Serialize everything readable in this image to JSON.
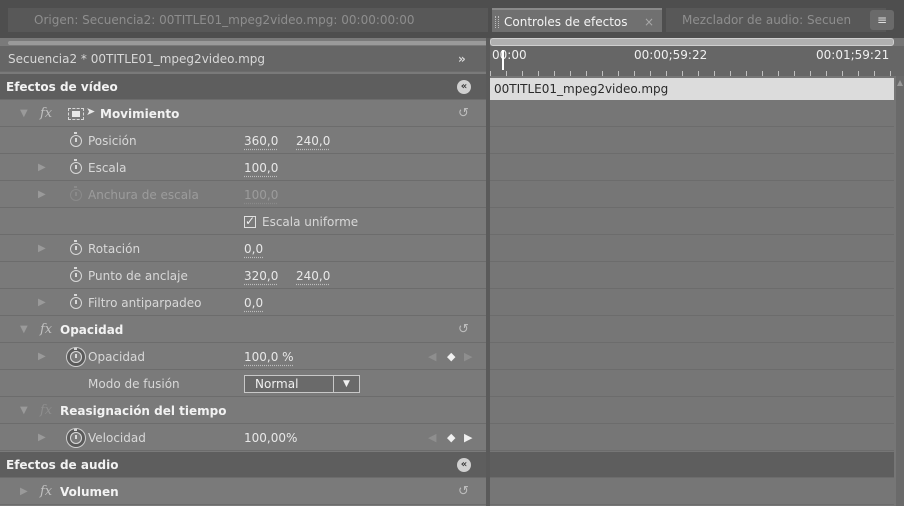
{
  "tabs": {
    "source": "Origen: Secuencia2: 00TITLE01_mpeg2video.mpg: 00:00:00:00",
    "effects": "Controles de efectos",
    "effects_close": "×",
    "mixer": "Mezclador de audio: Secuen",
    "menu_icon": "≡"
  },
  "left": {
    "sequence_label": "Secuencia2 * 00TITLE01_mpeg2video.mpg",
    "goto_icon": "»",
    "video_effects_label": "Efectos de vídeo",
    "collapse_icon": "«",
    "reset_icon": "↺",
    "fx_label": "fx",
    "motion": {
      "label": "Movimiento",
      "position_label": "Posición",
      "position_x": "360,0",
      "position_y": "240,0",
      "scale_label": "Escala",
      "scale_value": "100,0",
      "scale_width_label": "Anchura de escala",
      "scale_width_value": "100,0",
      "uniform_scale_label": "Escala uniforme",
      "rotation_label": "Rotación",
      "rotation_value": "0,0",
      "anchor_label": "Punto de anclaje",
      "anchor_x": "320,0",
      "anchor_y": "240,0",
      "antiflicker_label": "Filtro antiparpadeo",
      "antiflicker_value": "0,0"
    },
    "opacity": {
      "label": "Opacidad",
      "opacity_label": "Opacidad",
      "opacity_value": "100,0 %",
      "blend_label": "Modo de fusión",
      "blend_value": "Normal"
    },
    "time_remap": {
      "label": "Reasignación del tiempo",
      "speed_label": "Velocidad",
      "speed_value": "100,00%"
    },
    "audio_effects_label": "Efectos de audio",
    "volume_label": "Volumen"
  },
  "right": {
    "timecode_start": "00:00",
    "timecode_mid": "00:00;59:22",
    "timecode_end": "00:01;59:21",
    "clip_name": "00TITLE01_mpeg2video.mpg"
  }
}
